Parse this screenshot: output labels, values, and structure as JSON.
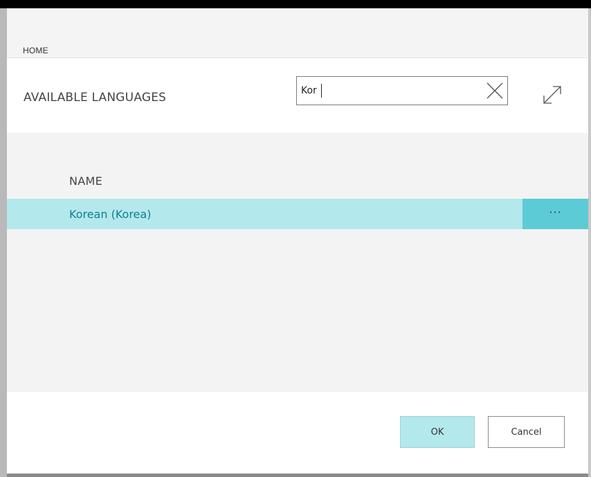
{
  "breadcrumb": {
    "label": "HOME"
  },
  "header": {
    "title": "AVAILABLE LANGUAGES",
    "search": {
      "value": "Kor",
      "clear_icon": "close-icon"
    },
    "expand_icon": "expand-icon"
  },
  "table": {
    "columns": [
      "NAME"
    ],
    "rows": [
      {
        "name": "Korean (Korea)",
        "actions_label": "···"
      }
    ]
  },
  "footer": {
    "ok_label": "OK",
    "cancel_label": "Cancel"
  },
  "colors": {
    "selected_row": "#b3e8ec",
    "row_actions": "#5dcbd6",
    "link_text": "#107f8f",
    "ok_button": "#b3e8ec"
  }
}
